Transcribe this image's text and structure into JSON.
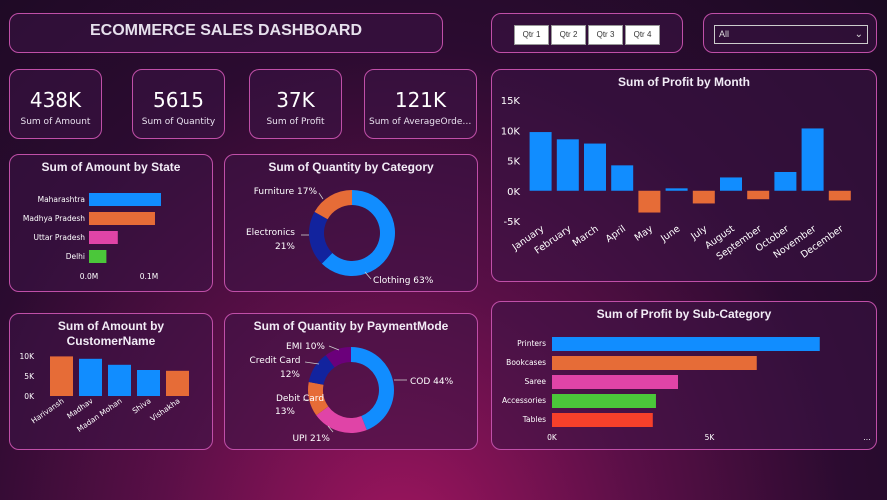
{
  "header": {
    "title": "ECOMMERCE SALES DASHBOARD"
  },
  "quarters": [
    "Qtr 1",
    "Qtr 2",
    "Qtr 3",
    "Qtr 4"
  ],
  "filter": {
    "selected": "All"
  },
  "kpis": [
    {
      "value": "438K",
      "label": "Sum of Amount"
    },
    {
      "value": "5615",
      "label": "Sum of Quantity"
    },
    {
      "value": "37K",
      "label": "Sum of Profit"
    },
    {
      "value": "121K",
      "label": "Sum of AverageOrder..."
    }
  ],
  "colors": {
    "blue": "#118dff",
    "orange": "#e66c37",
    "pink": "#e044a7",
    "green": "#4bc73a",
    "navy": "#12239e",
    "purple": "#6b007b",
    "red": "#f6402a"
  },
  "chart_data": [
    {
      "type": "bar",
      "title": "Sum of Amount by State",
      "orientation": "horizontal",
      "categories": [
        "Maharashtra",
        "Madhya Pradesh",
        "Uttar Pradesh",
        "Delhi"
      ],
      "values": [
        0.12,
        0.11,
        0.048,
        0.029
      ],
      "xticks": [
        "0.0M",
        "0.1M"
      ],
      "xlim": [
        0,
        0.1417
      ]
    },
    {
      "type": "pie",
      "title": "Sum of Quantity by Category",
      "labels": [
        "Clothing 63%",
        "Electronics 21%",
        "Furniture 17%"
      ],
      "values": [
        63,
        21,
        17
      ]
    },
    {
      "type": "bar",
      "title": "Sum of Profit by Month",
      "categories": [
        "January",
        "February",
        "March",
        "April",
        "May",
        "June",
        "July",
        "August",
        "September",
        "October",
        "November",
        "December"
      ],
      "values": [
        9700,
        8500,
        7800,
        4200,
        -3600,
        400,
        -2100,
        2200,
        -1400,
        3100,
        10300,
        -1600
      ],
      "yticks": [
        "15K",
        "10K",
        "5K",
        "0K",
        "-5K"
      ],
      "ylim": [
        -5000,
        15000
      ]
    },
    {
      "type": "bar",
      "title": "Sum of Amount by CustomerName",
      "categories": [
        "Harivansh",
        "Madhav",
        "Madan Mohan",
        "Shiva",
        "Vishakha"
      ],
      "values": [
        9900,
        9300,
        7800,
        6500,
        6300
      ],
      "yticks": [
        "10K",
        "5K",
        "0K"
      ],
      "ylim": [
        0,
        10000
      ]
    },
    {
      "type": "pie",
      "title": "Sum of Quantity by PaymentMode",
      "labels": [
        "COD 44%",
        "UPI 21%",
        "Debit Card 13%",
        "Credit Card 12%",
        "EMI 10%"
      ],
      "values": [
        44,
        21,
        13,
        12,
        10
      ]
    },
    {
      "type": "bar",
      "title": "Sum of Profit by Sub-Category",
      "orientation": "horizontal",
      "categories": [
        "Printers",
        "Bookcases",
        "Saree",
        "Accessories",
        "Tables"
      ],
      "values": [
        8500,
        6500,
        4000,
        3300,
        3200
      ],
      "xticks": [
        "0K",
        "5K",
        "..."
      ],
      "xlim": [
        0,
        10000
      ]
    }
  ]
}
